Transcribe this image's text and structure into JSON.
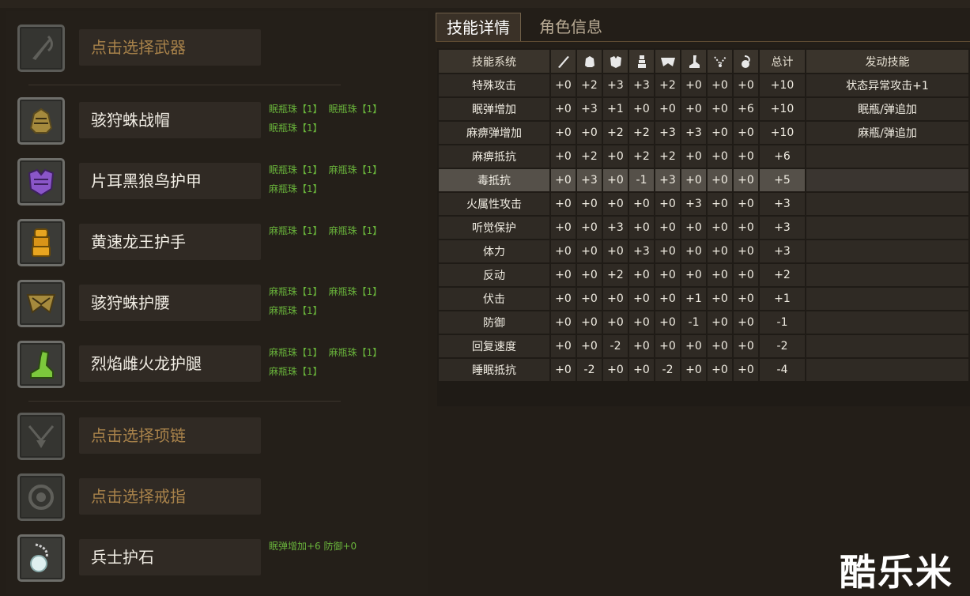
{
  "equipment": [
    {
      "name": "点击选择武器",
      "placeholder": true,
      "icon": "weapon-slot-icon",
      "decos": []
    },
    {
      "name": "骇狩蛛战帽",
      "placeholder": false,
      "icon": "helmet-icon",
      "decos": [
        "眠瓶珠【1】",
        "眠瓶珠【1】",
        "眠瓶珠【1】"
      ]
    },
    {
      "name": "片耳黑狼鸟护甲",
      "placeholder": false,
      "icon": "chest-armor-icon",
      "decos": [
        "眠瓶珠【1】",
        "麻瓶珠【1】",
        "麻瓶珠【1】"
      ]
    },
    {
      "name": "黄速龙王护手",
      "placeholder": false,
      "icon": "gauntlet-icon",
      "decos": [
        "麻瓶珠【1】",
        "麻瓶珠【1】"
      ]
    },
    {
      "name": "骇狩蛛护腰",
      "placeholder": false,
      "icon": "waist-icon",
      "decos": [
        "麻瓶珠【1】",
        "麻瓶珠【1】",
        "麻瓶珠【1】"
      ]
    },
    {
      "name": "烈焰雌火龙护腿",
      "placeholder": false,
      "icon": "legs-icon",
      "decos": [
        "麻瓶珠【1】",
        "麻瓶珠【1】",
        "麻瓶珠【1】"
      ]
    },
    {
      "name": "点击选择项链",
      "placeholder": true,
      "icon": "necklace-slot-icon",
      "decos": []
    },
    {
      "name": "点击选择戒指",
      "placeholder": true,
      "icon": "ring-slot-icon",
      "decos": []
    },
    {
      "name": "兵士护石",
      "placeholder": false,
      "icon": "charm-icon",
      "decos": [
        "眠弹增加+6 防御+0"
      ]
    }
  ],
  "tabs": {
    "active": "技能详情",
    "inactive": "角色信息"
  },
  "table": {
    "header_skill": "技能系统",
    "header_icons": [
      "weapon-icon",
      "helmet-icon",
      "chest-icon",
      "arm-icon",
      "waist-icon",
      "leg-icon",
      "necklace-icon",
      "charm-icon"
    ],
    "header_total": "总计",
    "header_activated": "发动技能",
    "rows": [
      {
        "skill": "特殊攻击",
        "vals": [
          "+0",
          "+2",
          "+3",
          "+3",
          "+2",
          "+0",
          "+0",
          "+0"
        ],
        "total": "+10",
        "activated": "状态异常攻击+1"
      },
      {
        "skill": "眠弹增加",
        "vals": [
          "+0",
          "+3",
          "+1",
          "+0",
          "+0",
          "+0",
          "+0",
          "+6"
        ],
        "total": "+10",
        "activated": "眠瓶/弹追加"
      },
      {
        "skill": "麻痹弹增加",
        "vals": [
          "+0",
          "+0",
          "+2",
          "+2",
          "+3",
          "+3",
          "+0",
          "+0"
        ],
        "total": "+10",
        "activated": "麻瓶/弹追加"
      },
      {
        "skill": "麻痹抵抗",
        "vals": [
          "+0",
          "+2",
          "+0",
          "+2",
          "+2",
          "+0",
          "+0",
          "+0"
        ],
        "total": "+6",
        "activated": ""
      },
      {
        "skill": "毒抵抗",
        "vals": [
          "+0",
          "+3",
          "+0",
          "-1",
          "+3",
          "+0",
          "+0",
          "+0"
        ],
        "total": "+5",
        "activated": "",
        "highlight": true
      },
      {
        "skill": "火属性攻击",
        "vals": [
          "+0",
          "+0",
          "+0",
          "+0",
          "+0",
          "+3",
          "+0",
          "+0"
        ],
        "total": "+3",
        "activated": ""
      },
      {
        "skill": "听觉保护",
        "vals": [
          "+0",
          "+0",
          "+3",
          "+0",
          "+0",
          "+0",
          "+0",
          "+0"
        ],
        "total": "+3",
        "activated": ""
      },
      {
        "skill": "体力",
        "vals": [
          "+0",
          "+0",
          "+0",
          "+3",
          "+0",
          "+0",
          "+0",
          "+0"
        ],
        "total": "+3",
        "activated": ""
      },
      {
        "skill": "反动",
        "vals": [
          "+0",
          "+0",
          "+2",
          "+0",
          "+0",
          "+0",
          "+0",
          "+0"
        ],
        "total": "+2",
        "activated": ""
      },
      {
        "skill": "伏击",
        "vals": [
          "+0",
          "+0",
          "+0",
          "+0",
          "+0",
          "+1",
          "+0",
          "+0"
        ],
        "total": "+1",
        "activated": ""
      },
      {
        "skill": "防御",
        "vals": [
          "+0",
          "+0",
          "+0",
          "+0",
          "+0",
          "-1",
          "+0",
          "+0"
        ],
        "total": "-1",
        "activated": ""
      },
      {
        "skill": "回复速度",
        "vals": [
          "+0",
          "+0",
          "-2",
          "+0",
          "+0",
          "+0",
          "+0",
          "+0"
        ],
        "total": "-2",
        "activated": ""
      },
      {
        "skill": "睡眠抵抗",
        "vals": [
          "+0",
          "-2",
          "+0",
          "+0",
          "-2",
          "+0",
          "+0",
          "+0"
        ],
        "total": "-4",
        "activated": ""
      }
    ]
  },
  "watermark": "酷乐米"
}
